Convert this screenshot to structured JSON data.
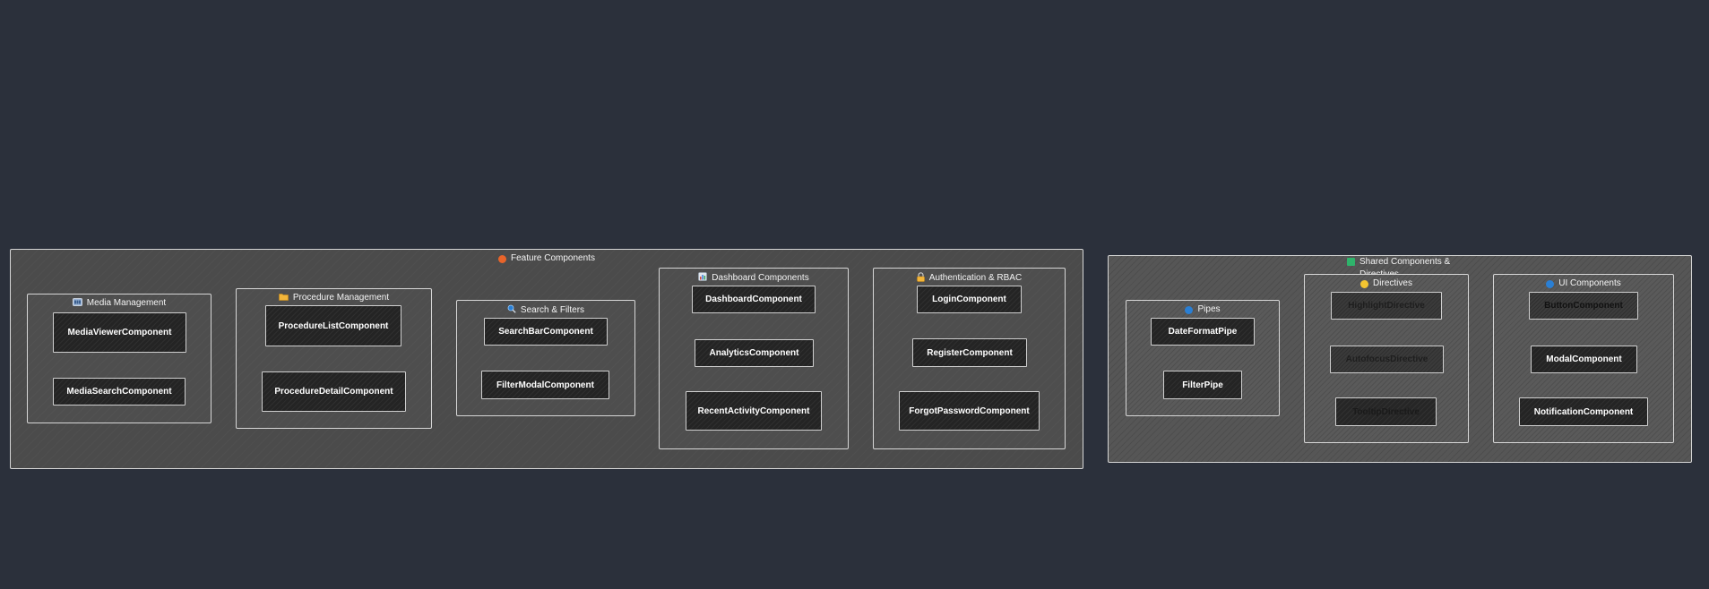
{
  "feature": {
    "title": "Feature Components",
    "color": "#e8642a",
    "media": {
      "title": "Media Management",
      "viewer": "MediaViewerComponent",
      "search": "MediaSearchComponent"
    },
    "procedure": {
      "title": "Procedure Management",
      "list": "ProcedureListComponent",
      "detail": "ProcedureDetailComponent"
    },
    "search": {
      "title": "Search & Filters",
      "bar": "SearchBarComponent",
      "modal": "FilterModalComponent"
    },
    "dashboard": {
      "title": "Dashboard Components",
      "main": "DashboardComponent",
      "analytics": "AnalyticsComponent",
      "recent": "RecentActivityComponent"
    },
    "auth": {
      "title": "Authentication & RBAC",
      "login": "LoginComponent",
      "register": "RegisterComponent",
      "forgot": "ForgotPasswordComponent"
    }
  },
  "shared": {
    "title": "Shared Components & Directives",
    "color": "#2fb36b",
    "pipes": {
      "title": "Pipes",
      "color": "#2a7fd4",
      "date": "DateFormatPipe",
      "filter": "FilterPipe"
    },
    "directives": {
      "title": "Directives",
      "color": "#f3c531",
      "highlight": "HighlightDirective",
      "autofocus": "AutofocusDirective",
      "tooltip": "TooltipDirective"
    },
    "ui": {
      "title": "UI Components",
      "color": "#2a7fd4",
      "button": "ButtonComponent",
      "modal": "ModalComponent",
      "notification": "NotificationComponent"
    }
  }
}
